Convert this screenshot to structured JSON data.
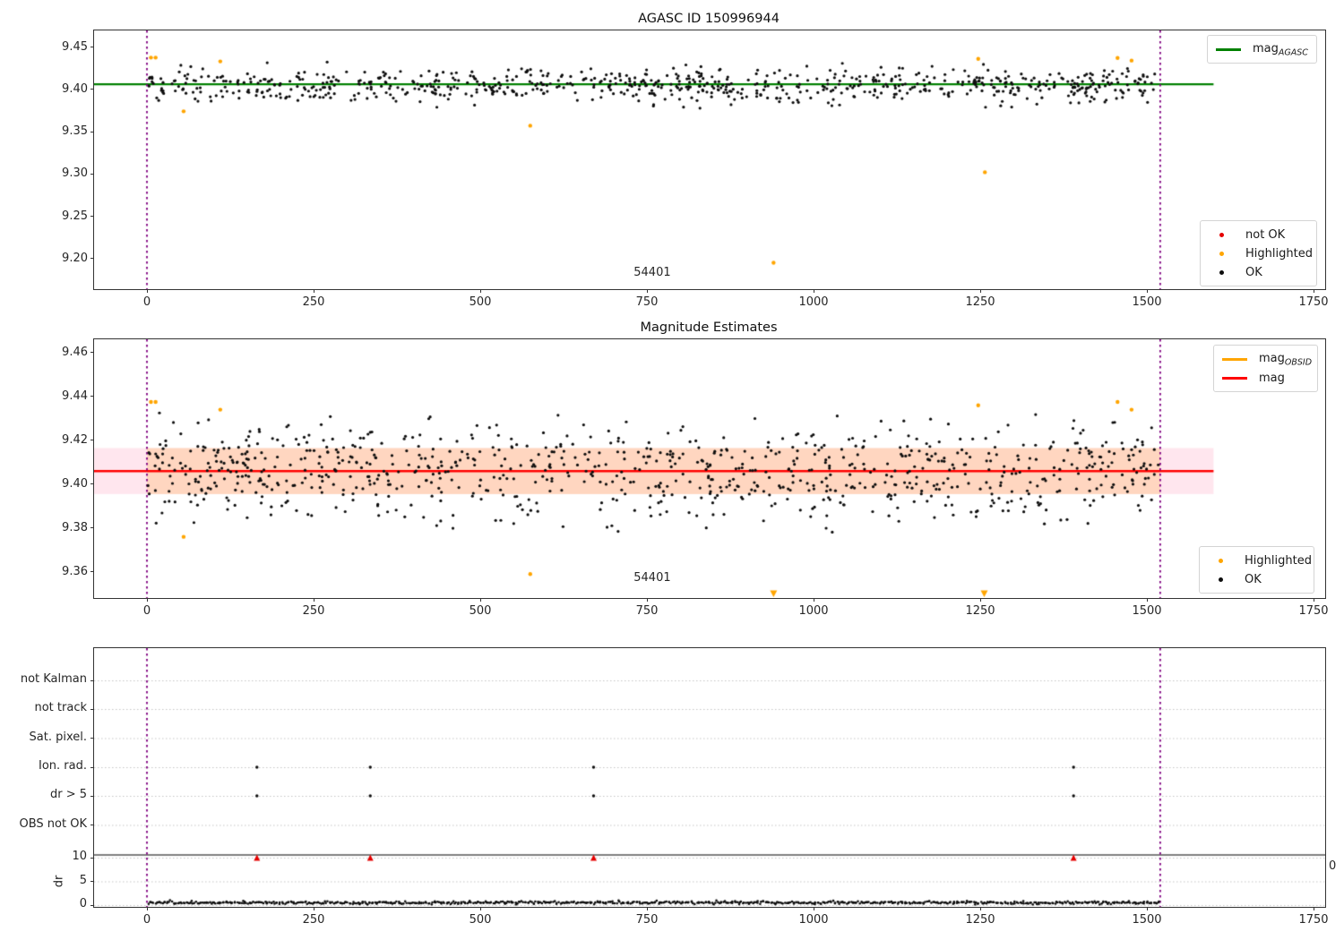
{
  "figure": {
    "background": "#ffffff"
  },
  "colors": {
    "agasc_line": "#008000",
    "mag_line": "#ff0000",
    "obsid_line": "#ffa500",
    "highlighted": "#ffa500",
    "ok": "#0d0d0d",
    "not_ok": "#e50000",
    "obs_boundary": "#800080",
    "grid": "#c4c4c4",
    "band_pink": "rgba(255,60,120,0.13)",
    "band_orange": "rgba(255,150,10,0.20)",
    "separator": "#000000"
  },
  "chart_data": [
    {
      "id": "agasc",
      "type": "scatter",
      "title": "AGASC ID 150996944",
      "xlim": [
        -79,
        1768
      ],
      "ylim": [
        9.1638,
        9.4696
      ],
      "xticks": [
        0,
        250,
        500,
        750,
        1000,
        1250,
        1500,
        1750
      ],
      "xtick_labels": [
        "0",
        "250",
        "500",
        "750",
        "1000",
        "1250",
        "1500",
        "1750"
      ],
      "yticks": [
        9.2,
        9.25,
        9.3,
        9.35,
        9.4,
        9.45
      ],
      "ytick_labels": [
        "9.20",
        "9.25",
        "9.30",
        "9.35",
        "9.40",
        "9.45"
      ],
      "grid": false,
      "agasc_mag_line": {
        "y": 9.406,
        "x_end": 1600
      },
      "obs_boundaries": [
        0,
        1520
      ],
      "annotation": {
        "text": "54401",
        "x": 758,
        "y": 9.183
      },
      "legend_line": {
        "position": "upper right",
        "entries": [
          {
            "type": "line",
            "color": "#008000",
            "label": "mag",
            "sub": "AGASC"
          }
        ]
      },
      "legend_markers": {
        "position": "lower right",
        "entries": [
          {
            "type": "dot",
            "color": "#e50000",
            "label": "not OK"
          },
          {
            "type": "dot",
            "color": "#ffa500",
            "label": "Highlighted"
          },
          {
            "type": "dot",
            "color": "#0d0d0d",
            "label": "OK"
          }
        ]
      },
      "highlighted_points": [
        [
          6,
          9.4375
        ],
        [
          13,
          9.4375
        ],
        [
          55,
          9.374
        ],
        [
          110,
          9.433
        ],
        [
          575,
          9.357
        ],
        [
          940,
          9.195
        ],
        [
          1247,
          9.436
        ],
        [
          1257,
          9.302
        ],
        [
          1456,
          9.437
        ],
        [
          1477,
          9.434
        ]
      ],
      "ok_scatter": {
        "n": 780,
        "seed": 20240601,
        "x_range": [
          1,
          1518
        ],
        "y_mean": 9.4052,
        "y_sd": 0.0105,
        "y_clip": [
          9.372,
          9.4335
        ]
      }
    },
    {
      "id": "mags",
      "type": "scatter",
      "title": "Magnitude Estimates",
      "xlim": [
        -79,
        1768
      ],
      "ylim": [
        9.3481,
        9.4661
      ],
      "xticks": [
        0,
        250,
        500,
        750,
        1000,
        1250,
        1500,
        1750
      ],
      "xtick_labels": [
        "0",
        "250",
        "500",
        "750",
        "1000",
        "1250",
        "1500",
        "1750"
      ],
      "yticks": [
        9.36,
        9.38,
        9.4,
        9.42,
        9.44,
        9.46
      ],
      "ytick_labels": [
        "9.36",
        "9.38",
        "9.40",
        "9.42",
        "9.44",
        "9.46"
      ],
      "grid": false,
      "mag_line": {
        "y": 9.406,
        "x_end": 1600
      },
      "mag_band": {
        "lo": 9.3955,
        "hi": 9.4165,
        "x_end": 1600
      },
      "obsid_band": {
        "lo": 9.3955,
        "hi": 9.4165,
        "x0": 0,
        "x1": 1520
      },
      "obs_boundaries": [
        0,
        1520
      ],
      "annotation": {
        "text": "54401",
        "x": 758,
        "y": 9.357
      },
      "legend_line": {
        "position": "upper right",
        "entries": [
          {
            "type": "thickline",
            "color": "#ffa500",
            "label": "mag",
            "sub": "OBSID"
          },
          {
            "type": "line",
            "color": "#ff0000",
            "label": "mag"
          }
        ]
      },
      "legend_markers": {
        "position": "lower right",
        "entries": [
          {
            "type": "dot",
            "color": "#ffa500",
            "label": "Highlighted"
          },
          {
            "type": "dot",
            "color": "#0d0d0d",
            "label": "OK"
          }
        ]
      },
      "highlighted_points": [
        [
          6,
          9.4375
        ],
        [
          13,
          9.4375
        ],
        [
          55,
          9.376
        ],
        [
          110,
          9.434
        ],
        [
          575,
          9.359
        ],
        [
          1247,
          9.436
        ],
        [
          1456,
          9.4375
        ],
        [
          1477,
          9.434
        ]
      ],
      "clipped_low_points_x": [
        940,
        1256
      ],
      "ok_scatter": {
        "n": 880,
        "seed": 777,
        "x_range": [
          1,
          1518
        ],
        "y_mean": 9.4055,
        "y_sd": 0.0113,
        "y_clip": [
          9.377,
          9.4335
        ]
      }
    },
    {
      "id": "flags",
      "type": "scatter",
      "title": "",
      "xlim": [
        -79,
        1768
      ],
      "xticks": [
        0,
        250,
        500,
        750,
        1000,
        1250,
        1500,
        1750
      ],
      "xtick_labels": [
        "0",
        "250",
        "500",
        "750",
        "1000",
        "1250",
        "1500",
        "1750"
      ],
      "categories": [
        "not Kalman",
        "not track",
        "Sat. pixel.",
        "Ion. rad.",
        "dr > 5",
        "OBS not OK"
      ],
      "dr_ticks": [
        10,
        5,
        0
      ],
      "dr_tick_labels": [
        "10",
        "5",
        "0"
      ],
      "dr_axis_label": "dr",
      "right_edge_label": "0",
      "grid": true,
      "obs_boundaries": [
        0,
        1520
      ],
      "flag_events": {
        "xs": [
          165,
          335,
          670,
          1390
        ],
        "rows": [
          "Ion. rad.",
          "dr > 5"
        ]
      },
      "dr_over_limit": {
        "xs": [
          165,
          335,
          670,
          1390
        ],
        "dr": 10
      },
      "dr_trace": {
        "n": 720,
        "seed": 31337,
        "x_range": [
          2,
          1518
        ],
        "base": 0.5,
        "sd": 0.16,
        "clip": [
          0.12,
          1.35
        ]
      }
    }
  ]
}
